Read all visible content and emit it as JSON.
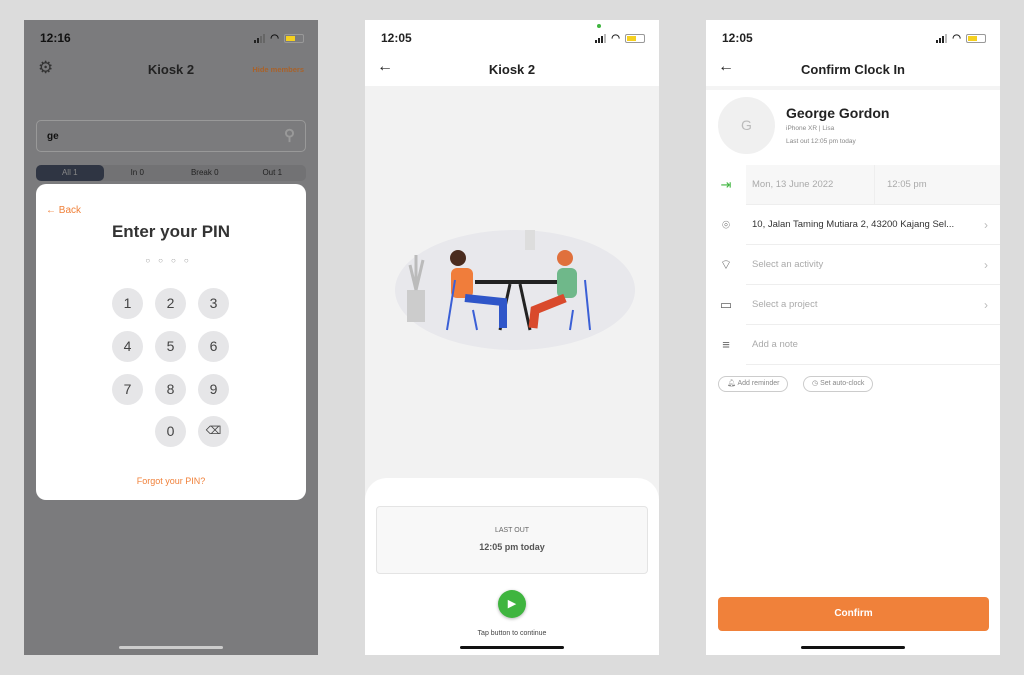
{
  "screen1": {
    "time": "12:16",
    "title": "Kiosk 2",
    "hide_members": "Hide members",
    "search_value": "ge",
    "filters": [
      "All 1",
      "In 0",
      "Break 0",
      "Out 1"
    ],
    "modal": {
      "back": "Back",
      "heading": "Enter your PIN",
      "keys": [
        "1",
        "2",
        "3",
        "4",
        "5",
        "6",
        "7",
        "8",
        "9",
        "0"
      ],
      "forgot": "Forgot your PIN?"
    }
  },
  "screen2": {
    "time": "12:05",
    "title": "Kiosk 2",
    "last_out_label": "LAST OUT",
    "last_out_value": "12:05 pm today",
    "hint": "Tap button to continue"
  },
  "screen3": {
    "time": "12:05",
    "title": "Confirm Clock In",
    "avatar_initial": "G",
    "name": "George Gordon",
    "device": "iPhone XR | Lisa",
    "last_out": "Last out 12:05 pm today",
    "date": "Mon, 13 June 2022",
    "clock_time": "12:05 pm",
    "location": "10, Jalan Taming Mutiara 2, 43200 Kajang Sel...",
    "activity_placeholder": "Select an activity",
    "project_placeholder": "Select a project",
    "note_placeholder": "Add a note",
    "add_reminder": "Add reminder",
    "auto_clock": "Set auto-clock",
    "confirm": "Confirm"
  },
  "colors": {
    "accent": "#f0813a",
    "green": "#3fb53f"
  }
}
